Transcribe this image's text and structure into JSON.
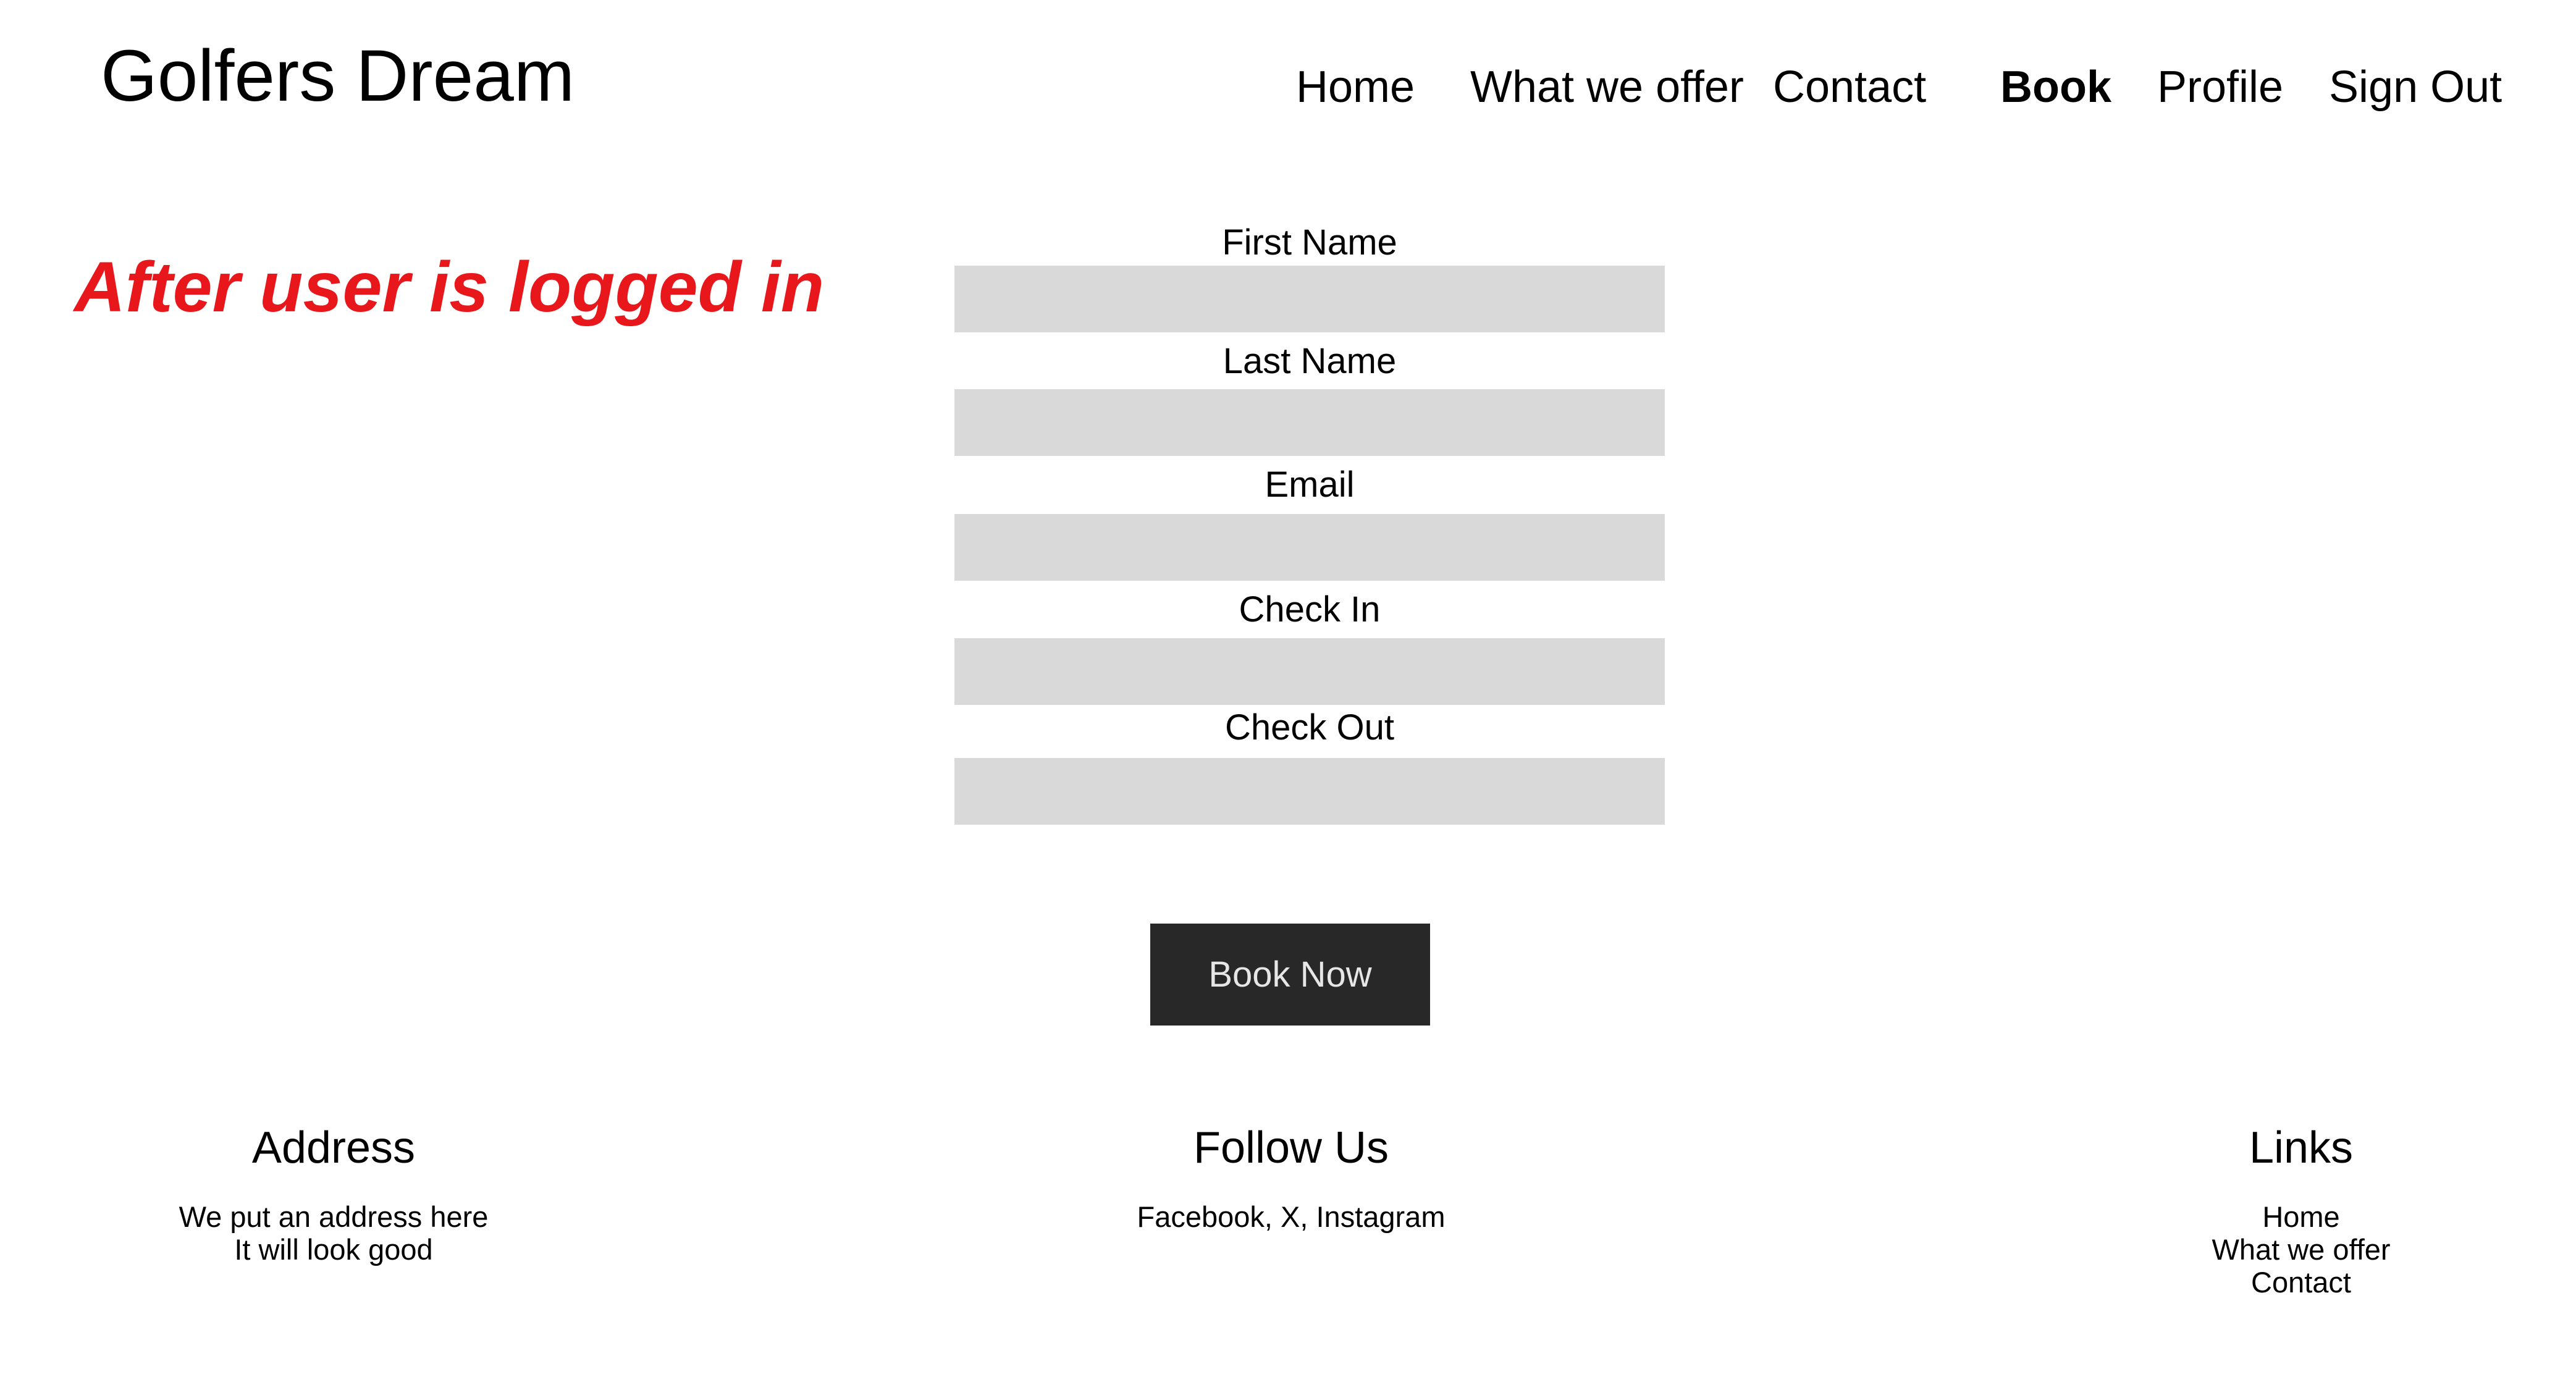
{
  "header": {
    "site_title": "Golfers Dream",
    "nav": [
      {
        "label": "Home",
        "active": false
      },
      {
        "label": "What we offer",
        "active": false
      },
      {
        "label": "Contact",
        "active": false
      },
      {
        "label": "Book",
        "active": true
      },
      {
        "label": "Profile",
        "active": false
      },
      {
        "label": "Sign Out",
        "active": false
      }
    ]
  },
  "annotation": {
    "text": "After user is logged in",
    "color": "#e8171b"
  },
  "form": {
    "fields": [
      {
        "label": "First Name",
        "value": ""
      },
      {
        "label": "Last Name",
        "value": ""
      },
      {
        "label": "Email",
        "value": ""
      },
      {
        "label": "Check In",
        "value": ""
      },
      {
        "label": "Check Out",
        "value": ""
      }
    ],
    "field_background": "#d9d9d9",
    "submit_label": "Book Now",
    "submit_background": "#282828"
  },
  "footer": {
    "address": {
      "heading": "Address",
      "lines": [
        "We put an address here",
        "It will look good"
      ]
    },
    "follow": {
      "heading": "Follow Us",
      "lines": [
        "Facebook, X, Instagram"
      ]
    },
    "links": {
      "heading": "Links",
      "items": [
        "Home",
        "What we offer",
        "Contact"
      ]
    }
  }
}
